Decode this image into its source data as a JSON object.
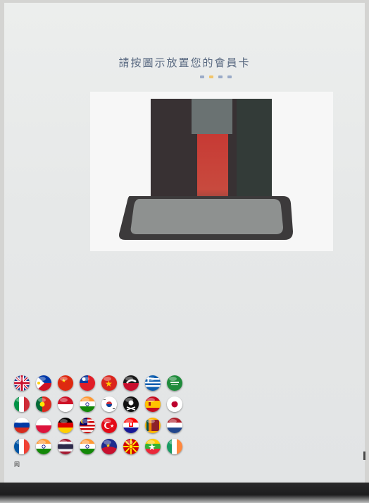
{
  "header": {
    "instruction": "請按圖示放置您的會員卡",
    "step_dots": [
      false,
      true,
      false,
      false
    ]
  },
  "illustration": {
    "icon": "card-reader-illustration",
    "colors": {
      "reader": "#383133",
      "card": "#c73a34",
      "tray": "#3c3a3b",
      "tray_inner": "#8e9190"
    }
  },
  "language_selector": {
    "flags": [
      {
        "name": "uk",
        "label": "English"
      },
      {
        "name": "philippines",
        "label": "Filipino"
      },
      {
        "name": "china",
        "label": "简体中文"
      },
      {
        "name": "taiwan",
        "label": "繁體中文"
      },
      {
        "name": "vietnam",
        "label": "Tiếng Việt"
      },
      {
        "name": "new-zealand-maori",
        "label": "Māori"
      },
      {
        "name": "greece",
        "label": "Ελληνικά"
      },
      {
        "name": "saudi-arabia",
        "label": "العربية"
      },
      {
        "name": "italy",
        "label": "Italiano"
      },
      {
        "name": "portugal",
        "label": "Português"
      },
      {
        "name": "indonesia",
        "label": "Bahasa Indonesia"
      },
      {
        "name": "india",
        "label": "हिन्दी"
      },
      {
        "name": "south-korea",
        "label": "한국어"
      },
      {
        "name": "pirate",
        "label": "Pirate"
      },
      {
        "name": "spain",
        "label": "Español"
      },
      {
        "name": "japan",
        "label": "日本語"
      },
      {
        "name": "russia",
        "label": "Русский"
      },
      {
        "name": "poland",
        "label": "Polski"
      },
      {
        "name": "germany",
        "label": "Deutsch"
      },
      {
        "name": "malaysia",
        "label": "Bahasa Melayu"
      },
      {
        "name": "turkey",
        "label": "Türkçe"
      },
      {
        "name": "croatia",
        "label": "Hrvatski"
      },
      {
        "name": "sri-lanka",
        "label": "සිංහල"
      },
      {
        "name": "netherlands",
        "label": "Nederlands"
      },
      {
        "name": "france",
        "label": "Français"
      },
      {
        "name": "india-2",
        "label": "தமிழ்"
      },
      {
        "name": "thailand",
        "label": "ไทย"
      },
      {
        "name": "india-3",
        "label": "বাংলা"
      },
      {
        "name": "philippines-2",
        "label": "Cebuano"
      },
      {
        "name": "macedonia",
        "label": "Македонски"
      },
      {
        "name": "myanmar",
        "label": "မြန်မာ"
      },
      {
        "name": "ireland",
        "label": "Gaeilge"
      }
    ],
    "footer_text": "网"
  }
}
